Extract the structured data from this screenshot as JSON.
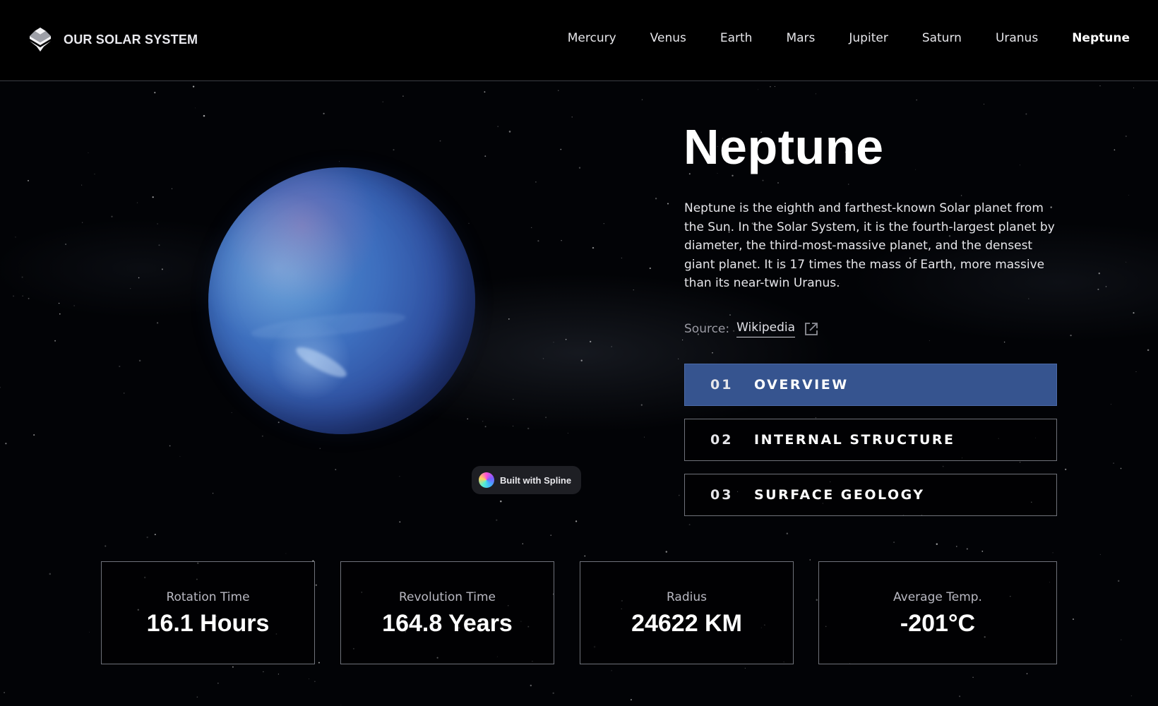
{
  "header": {
    "brand": "OUR SOLAR SYSTEM",
    "nav": [
      {
        "label": "Mercury",
        "active": false
      },
      {
        "label": "Venus",
        "active": false
      },
      {
        "label": "Earth",
        "active": false
      },
      {
        "label": "Mars",
        "active": false
      },
      {
        "label": "Jupiter",
        "active": false
      },
      {
        "label": "Saturn",
        "active": false
      },
      {
        "label": "Uranus",
        "active": false
      },
      {
        "label": "Neptune",
        "active": true
      }
    ]
  },
  "planet": {
    "name": "Neptune",
    "description": "Neptune is the eighth and farthest-known Solar planet from the Sun. In the Solar System, it is the fourth-largest planet by diameter, the third-most-massive planet, and the densest giant planet. It is 17 times the mass of Earth, more massive than its near-twin Uranus.",
    "source_label": "Source:",
    "source_link": "Wikipedia",
    "icons": {
      "brand": "solar-system-logo-icon",
      "source": "external-link-icon",
      "badge": "spline-logo-icon"
    }
  },
  "badge": {
    "text": "Built with Spline"
  },
  "tabs": [
    {
      "num": "01",
      "label": "OVERVIEW",
      "active": true
    },
    {
      "num": "02",
      "label": "INTERNAL STRUCTURE",
      "active": false
    },
    {
      "num": "03",
      "label": "SURFACE GEOLOGY",
      "active": false
    }
  ],
  "stats": [
    {
      "label": "Rotation Time",
      "value": "16.1 Hours"
    },
    {
      "label": "Revolution Time",
      "value": "164.8 Years"
    },
    {
      "label": "Radius",
      "value": "24622 KM"
    },
    {
      "label": "Average Temp.",
      "value": "-201°C"
    }
  ],
  "colors": {
    "background": "#000000",
    "accent": "#36548f",
    "border": "#6f727a",
    "text": "#ffffff",
    "muted": "#9a9aa3"
  }
}
